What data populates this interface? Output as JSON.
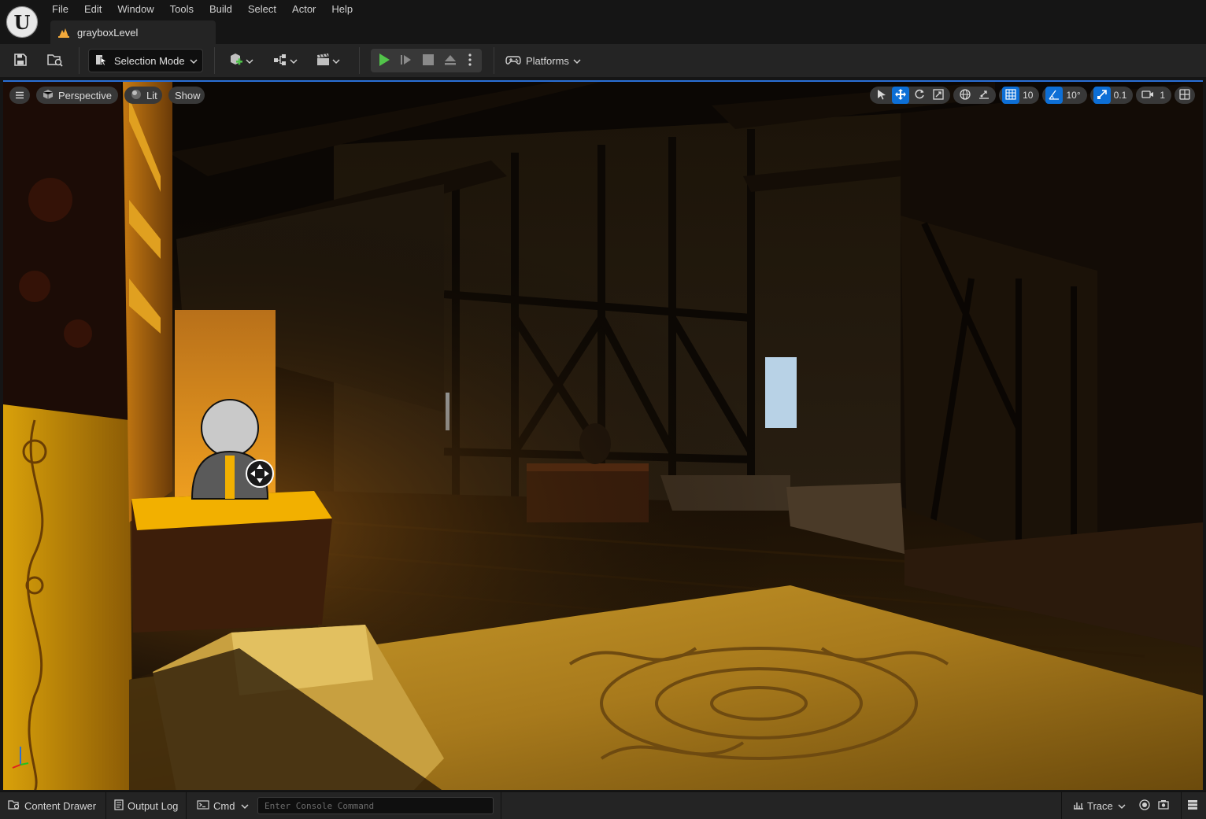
{
  "app": {
    "logo_text": "U"
  },
  "menu": [
    "File",
    "Edit",
    "Window",
    "Tools",
    "Build",
    "Select",
    "Actor",
    "Help"
  ],
  "level_tab": {
    "label": "grayboxLevel"
  },
  "toolbar": {
    "selection_mode": "Selection Mode",
    "platforms": "Platforms"
  },
  "viewport": {
    "view_mode": "Perspective",
    "lighting": "Lit",
    "show": "Show",
    "grid_snap": "10",
    "rotation_snap": "10°",
    "scale_snap": "0.1",
    "camera_speed": "1"
  },
  "statusbar": {
    "content_drawer": "Content Drawer",
    "output_log": "Output Log",
    "cmd": "Cmd",
    "console_placeholder": "Enter Console Command",
    "trace": "Trace"
  },
  "colors": {
    "accent_blue": "#0d6fd6",
    "play_green": "#52c44a",
    "warm_light": "#f2b000",
    "panel_bg": "#242424",
    "window_bg": "#151515"
  }
}
